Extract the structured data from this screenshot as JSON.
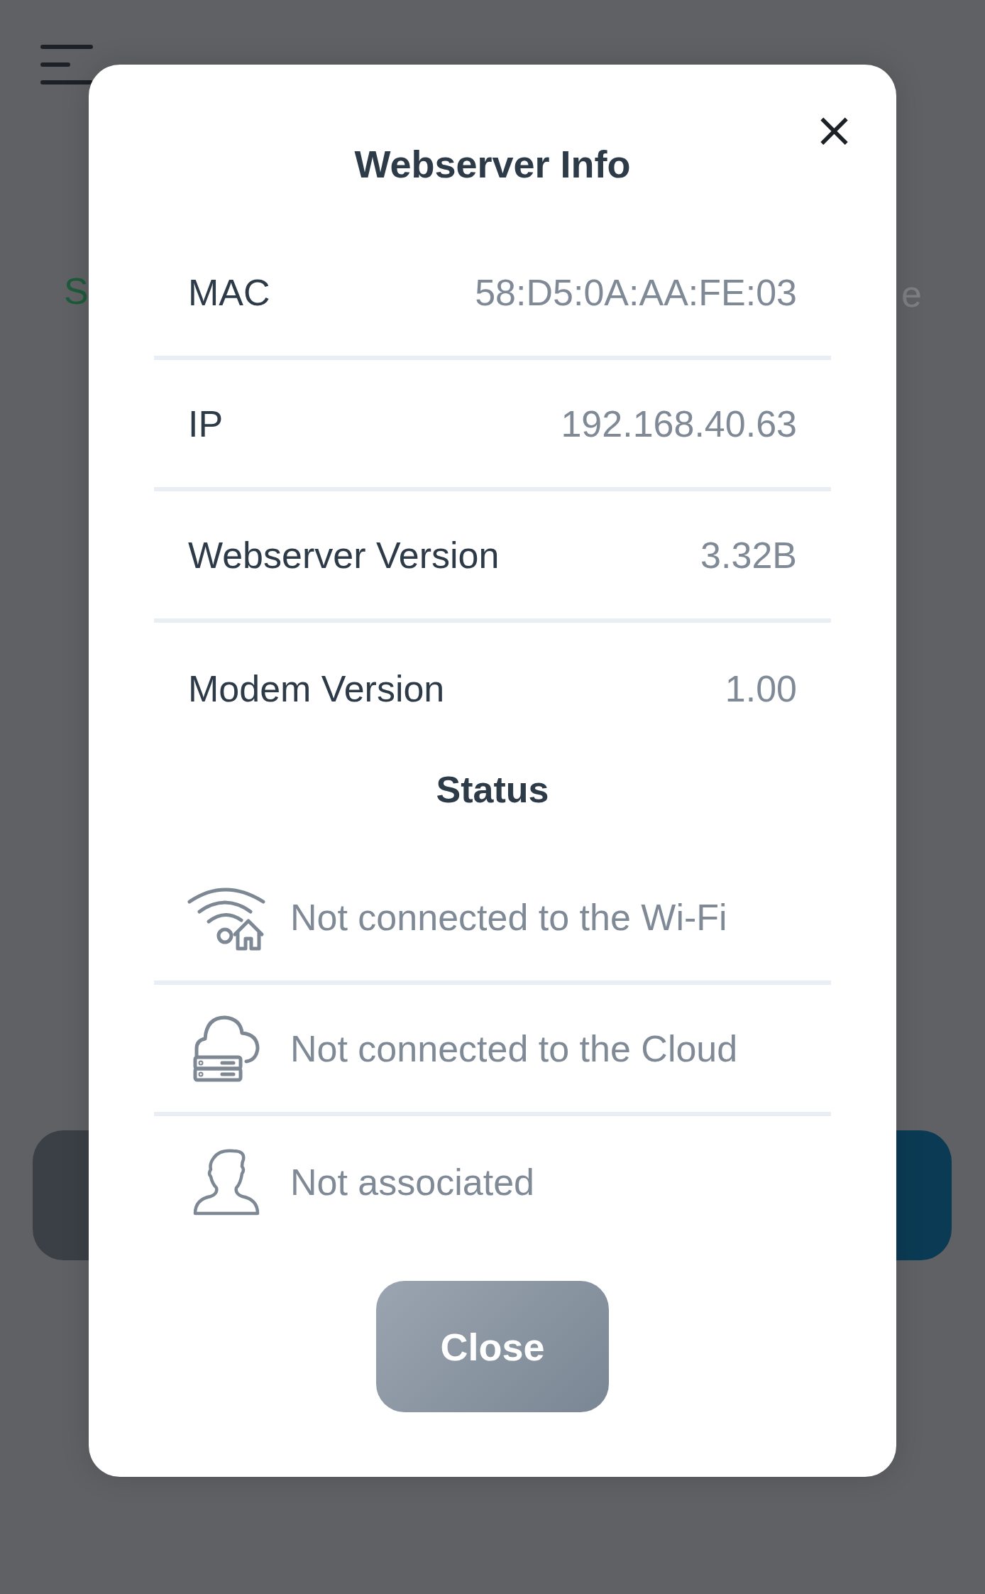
{
  "background": {
    "tab_left": "S",
    "tab_right": "e"
  },
  "dialog": {
    "title": "Webserver Info",
    "close_icon": "×",
    "rows": [
      {
        "label": "MAC",
        "value": "58:D5:0A:AA:FE:03"
      },
      {
        "label": "IP",
        "value": "192.168.40.63"
      },
      {
        "label": "Webserver Version",
        "value": "3.32B"
      },
      {
        "label": "Modem Version",
        "value": "1.00"
      }
    ],
    "status_title": "Status",
    "status": [
      {
        "kind": "wifi",
        "text": "Not connected to the Wi-Fi"
      },
      {
        "kind": "cloud",
        "text": "Not connected to the Cloud"
      },
      {
        "kind": "user",
        "text": "Not associated"
      }
    ],
    "close_button": "Close"
  }
}
